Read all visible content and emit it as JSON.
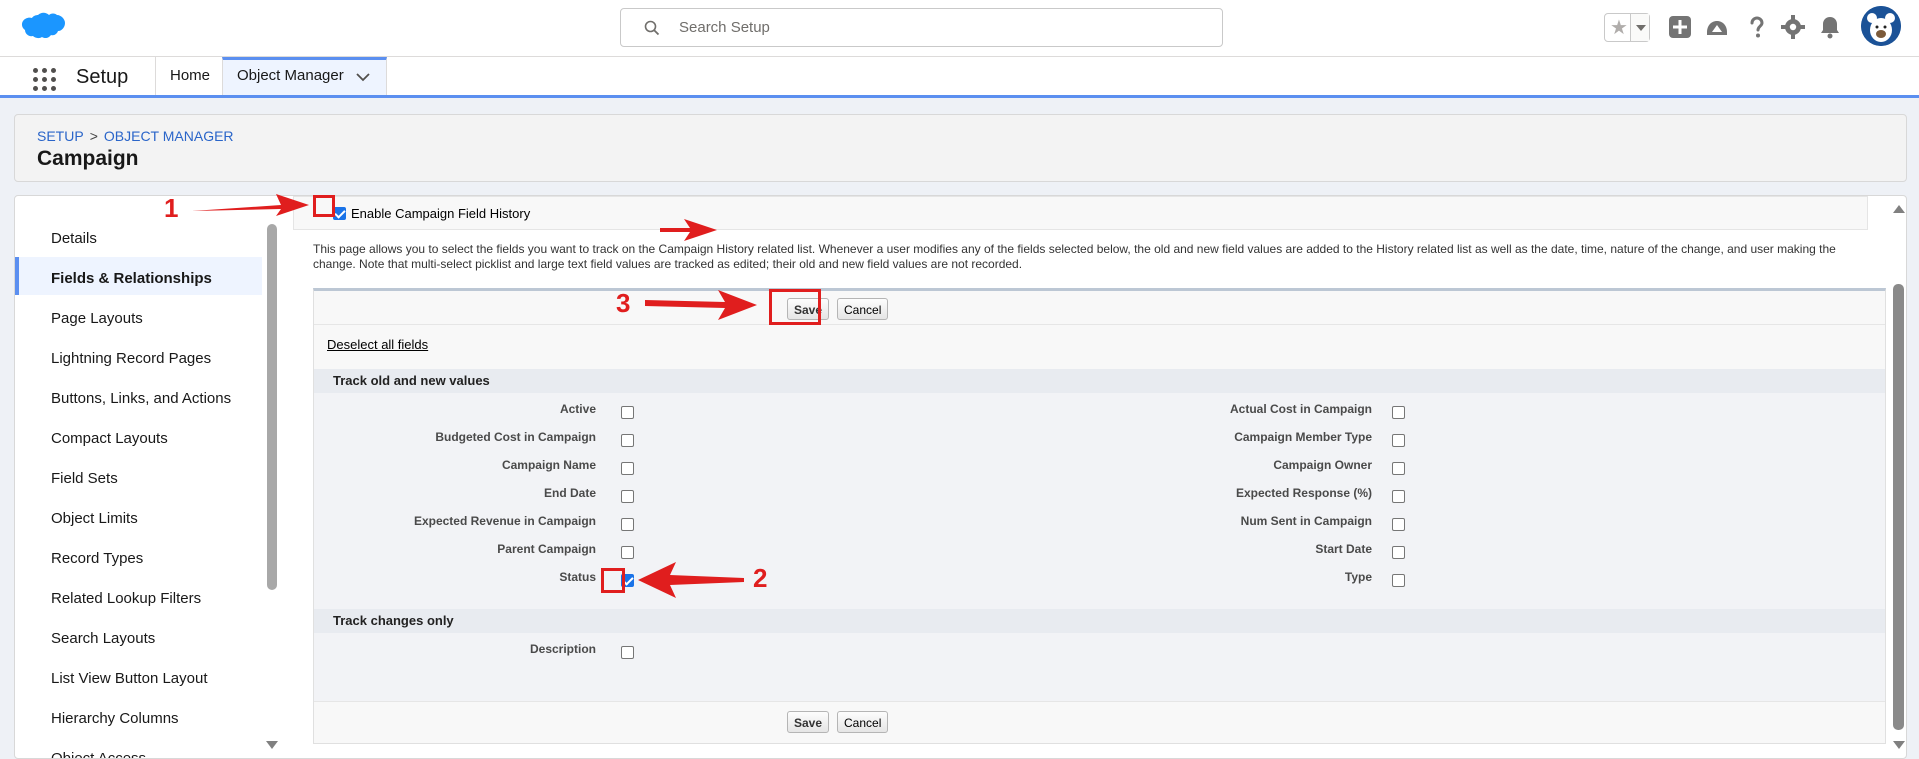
{
  "header": {
    "search_placeholder": "Search Setup",
    "icons": [
      "salesforce-cloud-logo",
      "favorites-star-icon",
      "add-icon",
      "trailhead-icon",
      "help-icon",
      "gear-icon",
      "bell-icon",
      "avatar"
    ]
  },
  "context": {
    "app_name": "Setup",
    "tabs": [
      {
        "label": "Home"
      },
      {
        "label": "Object Manager"
      }
    ]
  },
  "page": {
    "breadcrumb": [
      "SETUP",
      ">",
      "OBJECT MANAGER"
    ],
    "title": "Campaign"
  },
  "sidebar": {
    "items": [
      {
        "label": "Details"
      },
      {
        "label": "Fields & Relationships"
      },
      {
        "label": "Page Layouts"
      },
      {
        "label": "Lightning Record Pages"
      },
      {
        "label": "Buttons, Links, and Actions"
      },
      {
        "label": "Compact Layouts"
      },
      {
        "label": "Field Sets"
      },
      {
        "label": "Object Limits"
      },
      {
        "label": "Record Types"
      },
      {
        "label": "Related Lookup Filters"
      },
      {
        "label": "Search Layouts"
      },
      {
        "label": "List View Button Layout"
      },
      {
        "label": "Hierarchy Columns"
      },
      {
        "label": "Object Access"
      }
    ],
    "active_index": 1
  },
  "history": {
    "enable_label": "Enable Campaign Field History",
    "enable_checked": true,
    "intro": "This page allows you to select the fields you want to track on the Campaign History related list. Whenever a user modifies any of the fields selected below, the old and new field values are added to the History related list as well as the date, time, nature of the change, and user making the change. Note that multi-select picklist and large text field values are tracked as edited; their old and new field values are not recorded.",
    "save_label": "Save",
    "cancel_label": "Cancel",
    "deselect_label": "Deselect all fields",
    "section_old_new": "Track old and new values",
    "section_changes": "Track changes only",
    "left_fields": [
      {
        "label": "Active",
        "checked": false
      },
      {
        "label": "Budgeted Cost in Campaign",
        "checked": false
      },
      {
        "label": "Campaign Name",
        "checked": false
      },
      {
        "label": "End Date",
        "checked": false
      },
      {
        "label": "Expected Revenue in Campaign",
        "checked": false
      },
      {
        "label": "Parent Campaign",
        "checked": false
      },
      {
        "label": "Status",
        "checked": true
      }
    ],
    "right_fields": [
      {
        "label": "Actual Cost in Campaign",
        "checked": false
      },
      {
        "label": "Campaign Member Type",
        "checked": false
      },
      {
        "label": "Campaign Owner",
        "checked": false
      },
      {
        "label": "Expected Response (%)",
        "checked": false
      },
      {
        "label": "Num Sent in Campaign",
        "checked": false
      },
      {
        "label": "Start Date",
        "checked": false
      },
      {
        "label": "Type",
        "checked": false
      }
    ],
    "changes_fields": [
      {
        "label": "Description",
        "checked": false
      }
    ]
  },
  "annotations": {
    "step1": "1",
    "step2": "2",
    "step3": "3",
    "color": "#e01e1e"
  },
  "colors": {
    "brand_blue": "#1b96ff",
    "accent": "#5b8ff0",
    "link": "#2a65c9"
  }
}
